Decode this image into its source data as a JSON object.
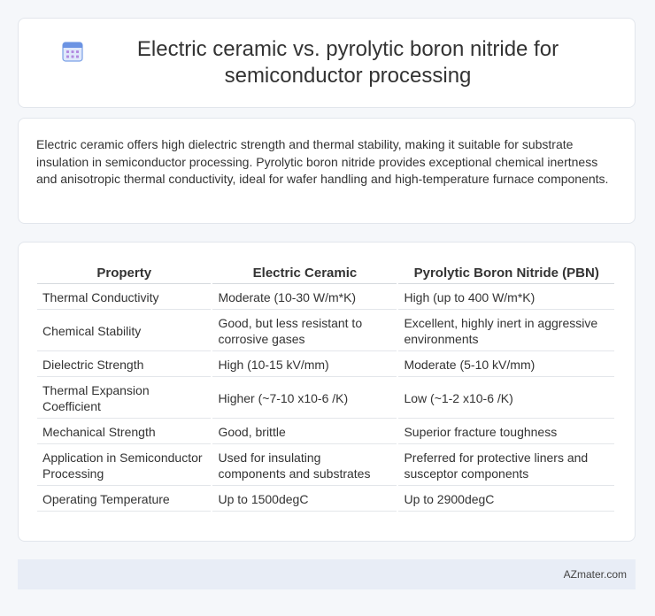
{
  "header": {
    "title": "Electric ceramic vs. pyrolytic boron nitride for semiconductor processing",
    "icon": "calendar-icon",
    "icon_color": "#4a7bd8"
  },
  "summary": {
    "text": "Electric ceramic offers high dielectric strength and thermal stability, making it suitable for substrate insulation in semiconductor processing. Pyrolytic boron nitride provides exceptional chemical inertness and anisotropic thermal conductivity, ideal for wafer handling and high-temperature furnace components."
  },
  "table": {
    "headers": [
      "Property",
      "Electric Ceramic",
      "Pyrolytic Boron Nitride (PBN)"
    ],
    "rows": [
      [
        "Thermal Conductivity",
        "Moderate (10-30 W/m*K)",
        "High (up to 400 W/m*K)"
      ],
      [
        "Chemical Stability",
        "Good, but less resistant to corrosive gases",
        "Excellent, highly inert in aggressive environments"
      ],
      [
        "Dielectric Strength",
        "High (10-15 kV/mm)",
        "Moderate (5-10 kV/mm)"
      ],
      [
        "Thermal Expansion Coefficient",
        "Higher (~7-10 x10-6 /K)",
        "Low (~1-2 x10-6 /K)"
      ],
      [
        "Mechanical Strength",
        "Good, brittle",
        "Superior fracture toughness"
      ],
      [
        "Application in Semiconductor Processing",
        "Used for insulating components and substrates",
        "Preferred for protective liners and susceptor components"
      ],
      [
        "Operating Temperature",
        "Up to 1500degC",
        "Up to 2900degC"
      ]
    ]
  },
  "footer": {
    "text": "AZmater.com"
  }
}
